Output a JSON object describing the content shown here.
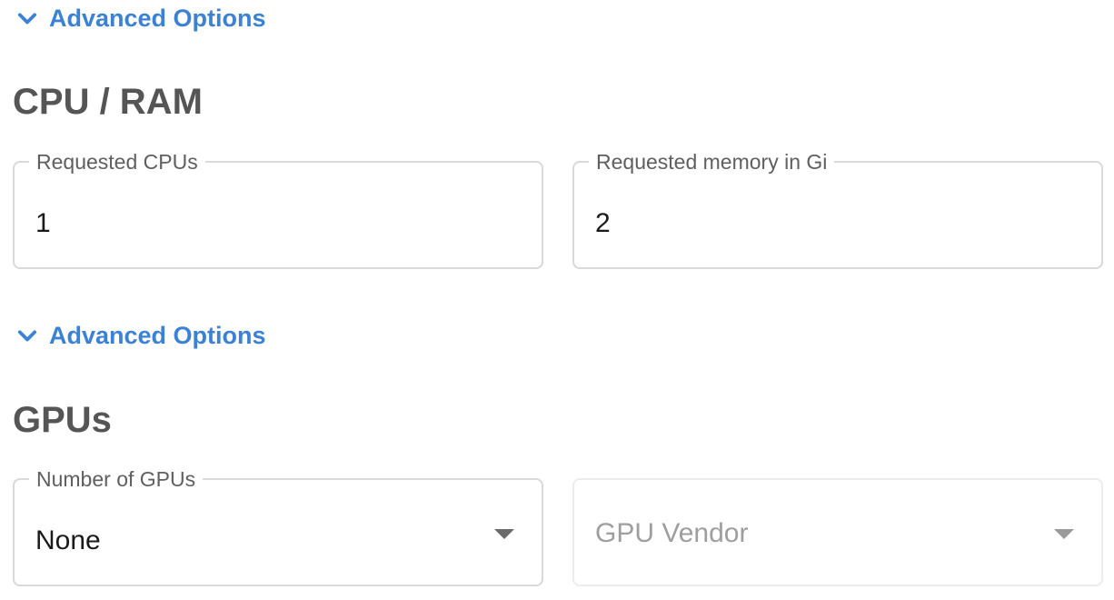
{
  "advanced_top": {
    "label": "Advanced Options",
    "icon": "chevron-down-icon"
  },
  "cpu_ram": {
    "title": "CPU / RAM",
    "cpu": {
      "label": "Requested CPUs",
      "value": "1"
    },
    "memory": {
      "label": "Requested memory in Gi",
      "value": "2"
    },
    "advanced": {
      "label": "Advanced Options",
      "icon": "chevron-down-icon"
    }
  },
  "gpus": {
    "title": "GPUs",
    "count": {
      "label": "Number of GPUs",
      "value": "None"
    },
    "vendor": {
      "placeholder": "GPU Vendor"
    }
  },
  "colors": {
    "accent": "#3b82d6",
    "heading": "#555555",
    "border": "#d9d9d9"
  }
}
